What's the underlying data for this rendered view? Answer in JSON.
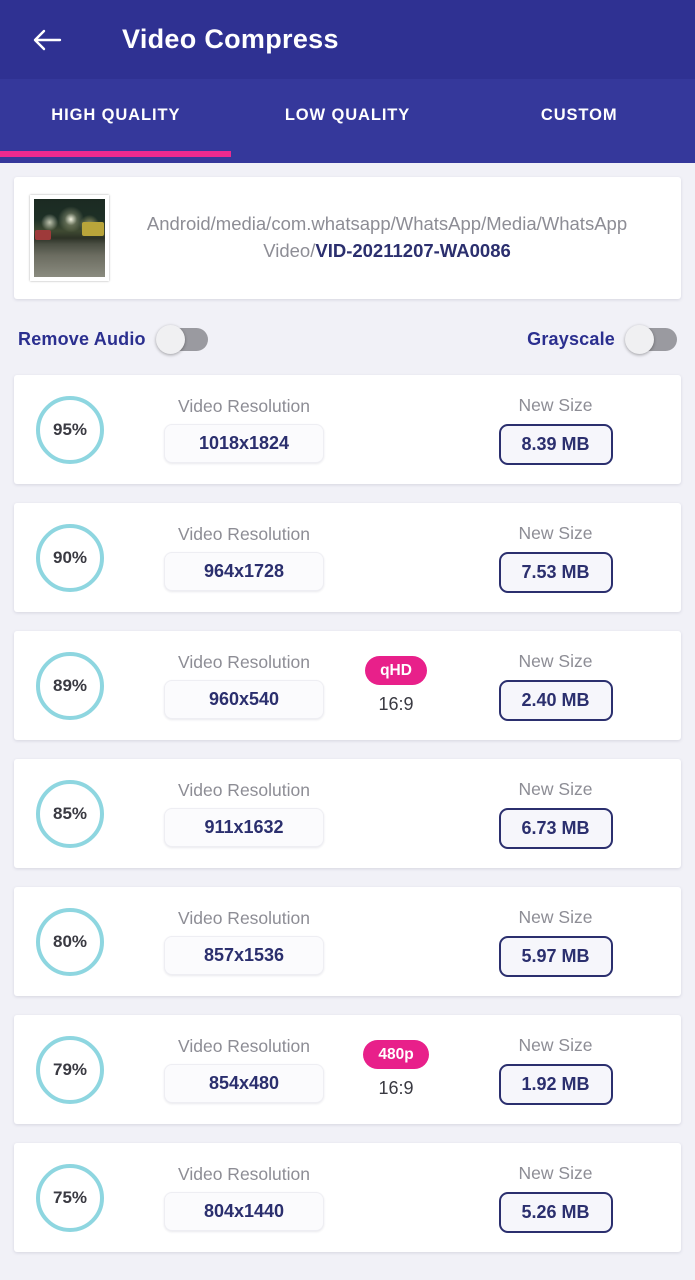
{
  "header": {
    "back_icon": "arrow-left-icon",
    "title": "Video Compress"
  },
  "tabs": [
    {
      "label": "HIGH QUALITY",
      "active": true
    },
    {
      "label": "LOW QUALITY",
      "active": false
    },
    {
      "label": "CUSTOM",
      "active": false
    }
  ],
  "colors": {
    "appbar": "#2f3192",
    "tabbar": "#35389b",
    "tab_indicator": "#ec2a8f",
    "badge_pink": "#e8208a",
    "ring_teal": "#8ed6e0",
    "navy_text": "#2b2f6e",
    "muted_text": "#8d8d95",
    "page_bg": "#f1f1f7"
  },
  "file": {
    "path_prefix": "Android/media/com.whatsapp/WhatsApp/Media/WhatsApp Video/",
    "file_name": "VID-20211207-WA0086",
    "thumbnail_alt": "video-thumbnail"
  },
  "options": {
    "remove_audio": {
      "label": "Remove Audio",
      "state": "off"
    },
    "grayscale": {
      "label": "Grayscale",
      "state": "off"
    }
  },
  "row_labels": {
    "resolution_label": "Video Resolution",
    "new_size_label": "New Size"
  },
  "rows": [
    {
      "percent": "95%",
      "resolution": "1018x1824",
      "badge": "",
      "aspect": "",
      "size": "8.39 MB"
    },
    {
      "percent": "90%",
      "resolution": "964x1728",
      "badge": "",
      "aspect": "",
      "size": "7.53 MB"
    },
    {
      "percent": "89%",
      "resolution": "960x540",
      "badge": "qHD",
      "aspect": "16:9",
      "size": "2.40 MB"
    },
    {
      "percent": "85%",
      "resolution": "911x1632",
      "badge": "",
      "aspect": "",
      "size": "6.73 MB"
    },
    {
      "percent": "80%",
      "resolution": "857x1536",
      "badge": "",
      "aspect": "",
      "size": "5.97 MB"
    },
    {
      "percent": "79%",
      "resolution": "854x480",
      "badge": "480p",
      "aspect": "16:9",
      "size": "1.92 MB"
    },
    {
      "percent": "75%",
      "resolution": "804x1440",
      "badge": "",
      "aspect": "",
      "size": "5.26 MB"
    }
  ]
}
